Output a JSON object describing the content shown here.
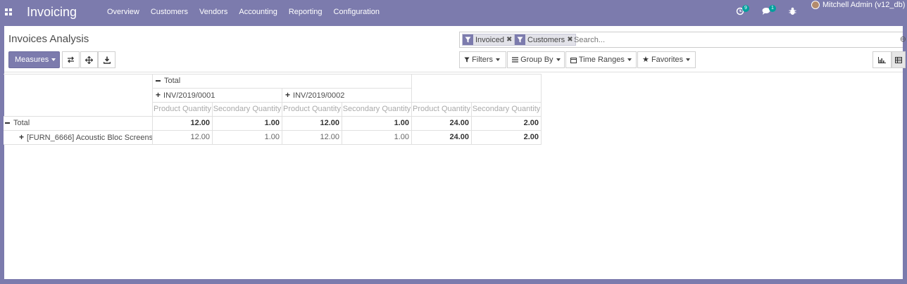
{
  "navbar": {
    "brand": "Invoicing",
    "menu": [
      "Overview",
      "Customers",
      "Vendors",
      "Accounting",
      "Reporting",
      "Configuration"
    ],
    "activity_badge": "9",
    "messages_badge": "1",
    "user_name": "Mitchell Admin (v12_db)"
  },
  "control": {
    "title": "Invoices Analysis",
    "measures_label": "Measures",
    "search": {
      "facets": [
        {
          "label": "Invoiced",
          "icon": "filter-icon"
        },
        {
          "label": "Customers",
          "icon": "filter-icon"
        }
      ],
      "placeholder": "Search..."
    },
    "filters_label": "Filters",
    "groupby_label": "Group By",
    "timeranges_label": "Time Ranges",
    "favorites_label": "Favorites"
  },
  "pivot": {
    "col_total": "Total",
    "col_groups": [
      "INV/2019/0001",
      "INV/2019/0002"
    ],
    "measures": [
      "Product Quantity",
      "Secondary Quantity",
      "Product Quantity",
      "Secondary Quantity",
      "Product Quantity",
      "Secondary Quantity"
    ],
    "rows": [
      {
        "label": "Total",
        "values": [
          "12.00",
          "1.00",
          "12.00",
          "1.00",
          "24.00",
          "2.00"
        ]
      },
      {
        "label": "[FURN_6666] Acoustic Bloc Screens",
        "values": [
          "12.00",
          "1.00",
          "12.00",
          "1.00",
          "24.00",
          "2.00"
        ]
      }
    ]
  }
}
